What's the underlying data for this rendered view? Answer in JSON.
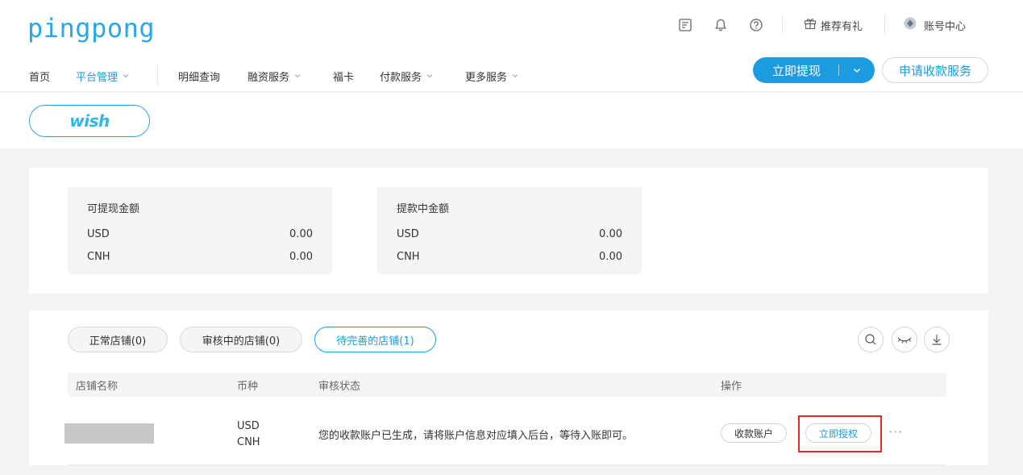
{
  "header": {
    "logo": "pingpong",
    "referral_label": "推荐有礼",
    "account_label": "账号中心",
    "icons": [
      "notes-icon",
      "bell-icon",
      "help-icon",
      "gift-icon",
      "account-icon"
    ]
  },
  "nav": {
    "items": [
      {
        "label": "首页",
        "dropdown": false,
        "active": false
      },
      {
        "label": "平台管理",
        "dropdown": true,
        "active": true
      },
      {
        "label": "明细查询",
        "dropdown": false,
        "active": false
      },
      {
        "label": "融资服务",
        "dropdown": true,
        "active": false
      },
      {
        "label": "福卡",
        "dropdown": false,
        "active": false
      },
      {
        "label": "付款服务",
        "dropdown": true,
        "active": false
      },
      {
        "label": "更多服务",
        "dropdown": true,
        "active": false
      }
    ],
    "withdraw_label": "立即提现",
    "apply_label": "申请收款服务"
  },
  "platform": {
    "selected": "wish"
  },
  "balances": {
    "available": {
      "title": "可提现金额",
      "rows": [
        {
          "currency": "USD",
          "amount": "0.00"
        },
        {
          "currency": "CNH",
          "amount": "0.00"
        }
      ]
    },
    "withdrawing": {
      "title": "提款中金额",
      "rows": [
        {
          "currency": "USD",
          "amount": "0.00"
        },
        {
          "currency": "CNH",
          "amount": "0.00"
        }
      ]
    }
  },
  "stores": {
    "tabs": [
      {
        "label": "正常店铺(0)",
        "active": false
      },
      {
        "label": "审核中的店铺(0)",
        "active": false
      },
      {
        "label": "待完善的店铺(1)",
        "active": true
      }
    ],
    "toolbar_icons": [
      "search-icon",
      "eye-closed-icon",
      "download-icon"
    ],
    "columns": [
      "店铺名称",
      "币种",
      "审核状态",
      "操作"
    ],
    "rows": [
      {
        "currencies": [
          "USD",
          "CNH"
        ],
        "status": "您的收款账户已生成，请将账户信息对应填入后台，等待入账即可。",
        "actions": [
          "收款账户",
          "立即授权"
        ],
        "more": "···"
      }
    ]
  },
  "colors": {
    "accent": "#1d9be0",
    "highlight": "#e0292b"
  }
}
